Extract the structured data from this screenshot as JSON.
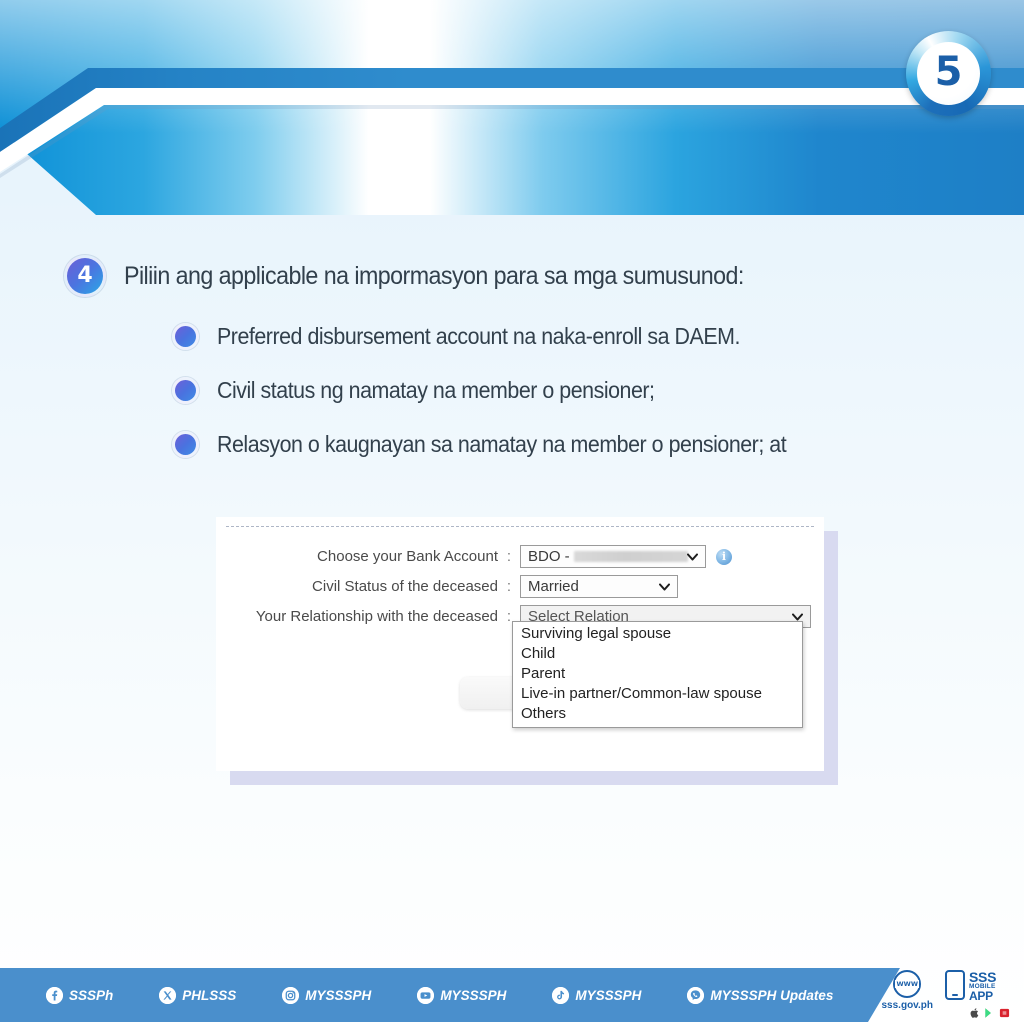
{
  "banner": {
    "step_number": "5"
  },
  "step": {
    "number": "4",
    "text": "Piliin ang applicable na impormasyon para sa mga sumusunod:"
  },
  "bullets": [
    {
      "text": "Preferred disbursement account na naka-enroll sa DAEM."
    },
    {
      "text": "Civil status ng namatay na member o pensioner;"
    },
    {
      "text": "Relasyon o kaugnayan sa namatay na member o pensioner; at"
    }
  ],
  "form": {
    "rows": [
      {
        "label": "Choose your Bank Account",
        "colon": ":",
        "value": "BDO -",
        "caret": "❯",
        "has_redaction": true,
        "has_info": true,
        "info_glyph": "i"
      },
      {
        "label": "Civil Status of the deceased",
        "colon": ":",
        "value": "Married",
        "caret": "❯",
        "has_redaction": false,
        "has_info": false
      },
      {
        "label": "Your Relationship with the deceased",
        "colon": ":",
        "value": "Select Relation",
        "caret": "❯",
        "has_redaction": false,
        "has_info": false
      }
    ],
    "relation_options": [
      "Surviving legal spouse",
      "Child",
      "Parent",
      "Live-in partner/Common-law spouse",
      "Others"
    ]
  },
  "footer": {
    "socials": [
      {
        "icon": "facebook-icon",
        "label": "SSSPh"
      },
      {
        "icon": "x-twitter-icon",
        "label": "PHLSSS"
      },
      {
        "icon": "instagram-icon",
        "label": "MYSSSPH"
      },
      {
        "icon": "youtube-icon",
        "label": "MYSSSPH"
      },
      {
        "icon": "tiktok-icon",
        "label": "MYSSSPH"
      },
      {
        "icon": "viber-icon",
        "label": "MYSSSPH Updates"
      }
    ],
    "website": {
      "globe_text": "WWW",
      "url": "sss.gov.ph"
    },
    "app": {
      "line1": "SSS",
      "line2": "MOBILE",
      "line3": "APP"
    }
  },
  "colors": {
    "banner_blue": "#1e7fc6",
    "footer_blue": "#4a8fcc",
    "accent_purple": "#5a63d8",
    "badge_number": "#1b5fa8"
  }
}
